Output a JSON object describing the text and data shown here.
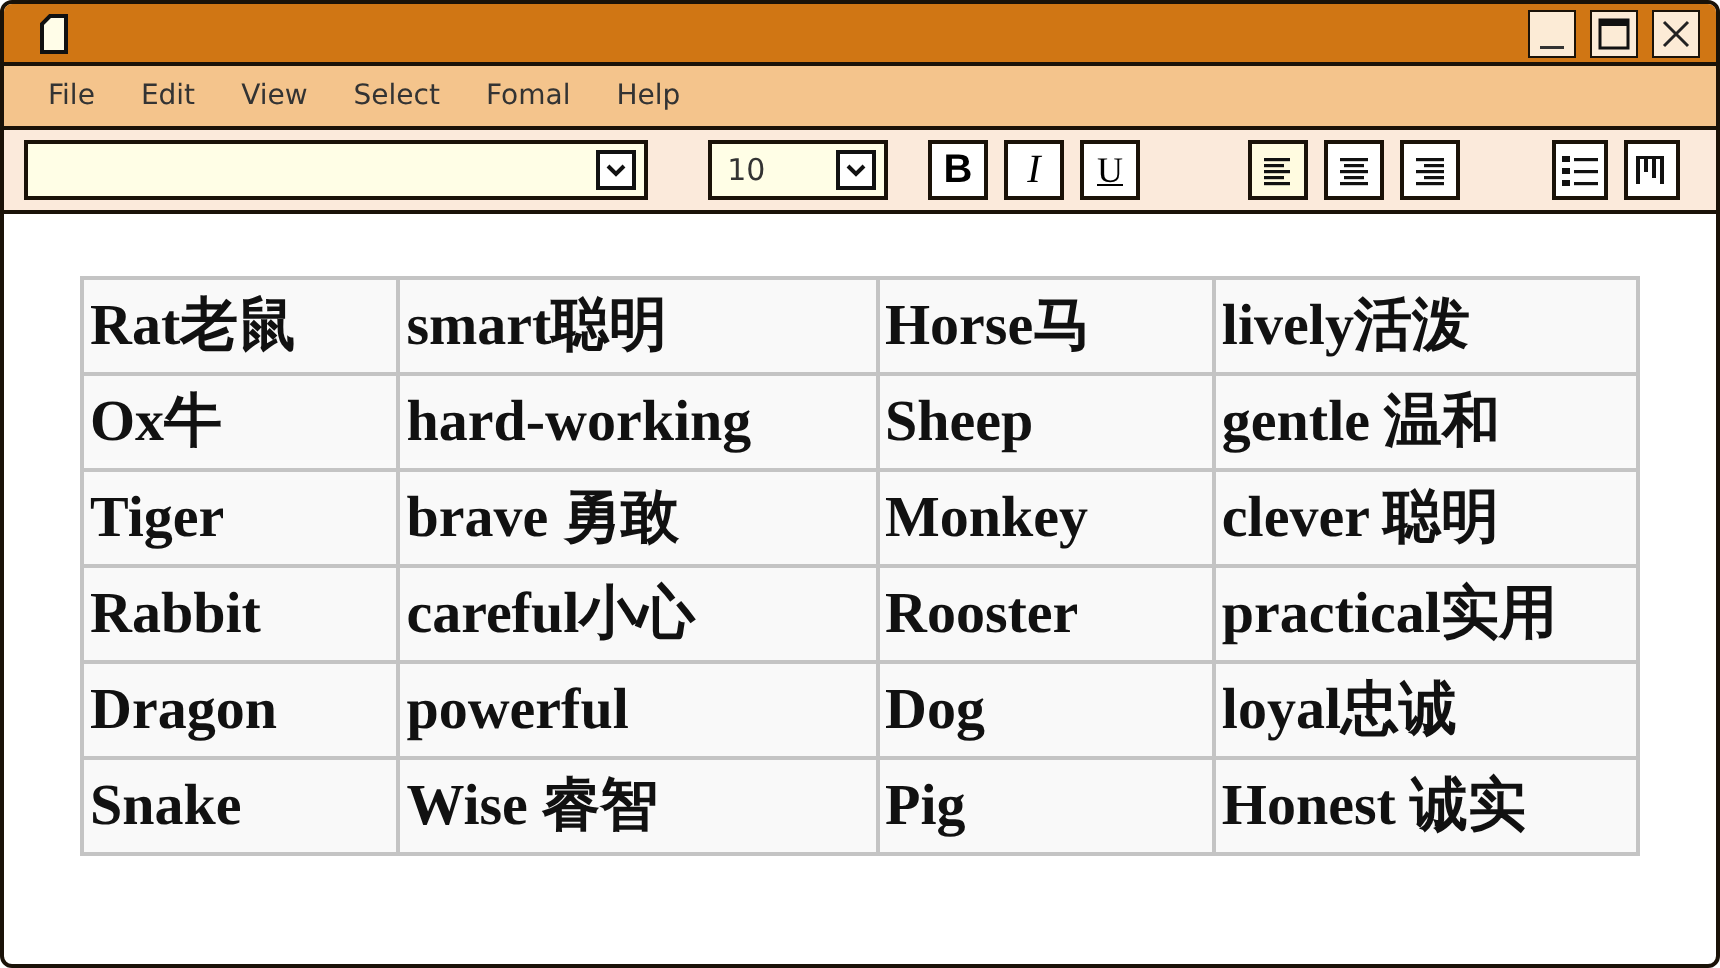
{
  "menu": [
    "File",
    "Edit",
    "View",
    "Select",
    "Fomal",
    "Help"
  ],
  "toolbar": {
    "font_size": "10",
    "style_buttons": [
      "B",
      "I",
      "U"
    ],
    "align_buttons": [
      {
        "kind": "left",
        "selected": true
      },
      {
        "kind": "center",
        "selected": false
      },
      {
        "kind": "right",
        "selected": false
      }
    ]
  },
  "table": {
    "rows": [
      [
        "Rat老鼠",
        "smart聪明",
        "Horse马",
        "lively活泼"
      ],
      [
        "Ox牛",
        "hard-working",
        "Sheep",
        "gentle 温和"
      ],
      [
        "Tiger",
        "brave 勇敢",
        "Monkey",
        "clever 聪明"
      ],
      [
        "Rabbit",
        "careful小心",
        "Rooster",
        "practical实用"
      ],
      [
        "Dragon",
        "powerful",
        "Dog",
        "loyal忠诚"
      ],
      [
        "Snake",
        "Wise 睿智",
        "Pig",
        "Honest 诚实"
      ]
    ]
  }
}
